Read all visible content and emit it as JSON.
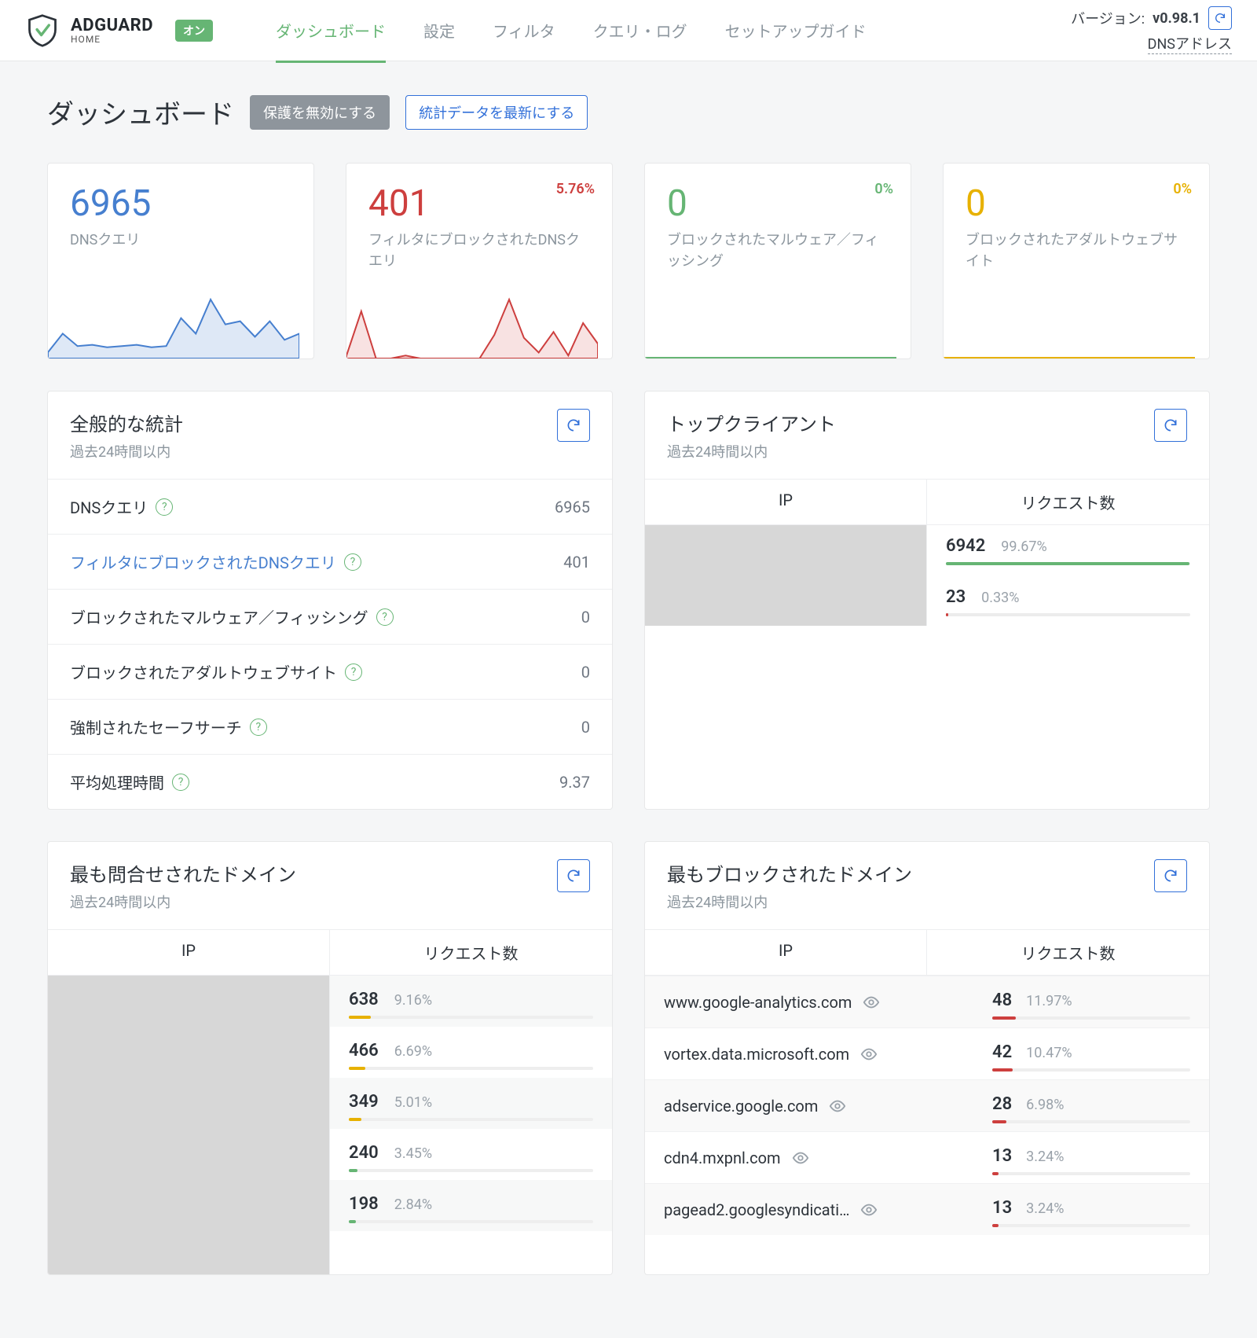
{
  "header": {
    "brand": "ADGUARD",
    "brand_sub": "HOME",
    "on_badge": "オン",
    "nav": [
      "ダッシュボード",
      "設定",
      "フィルタ",
      "クエリ・ログ",
      "セットアップガイド"
    ],
    "version_label": "バージョン:",
    "version_value": "v0.98.1",
    "dns_link": "DNSアドレス"
  },
  "page": {
    "title": "ダッシュボード",
    "btn_disable": "保護を無効にする",
    "btn_refresh_stats": "統計データを最新にする"
  },
  "stats_cards": [
    {
      "num": "6965",
      "label": "DNSクエリ",
      "pct": "",
      "color": "blue"
    },
    {
      "num": "401",
      "label": "フィルタにブロックされたDNSクエリ",
      "pct": "5.76%",
      "color": "red"
    },
    {
      "num": "0",
      "label": "ブロックされたマルウェア／フィッシング",
      "pct": "0%",
      "color": "green"
    },
    {
      "num": "0",
      "label": "ブロックされたアダルトウェブサイト",
      "pct": "0%",
      "color": "yellow"
    }
  ],
  "general_stats": {
    "title": "全般的な統計",
    "subtitle": "過去24時間以内",
    "rows": [
      {
        "name": "DNSクエリ",
        "value": "6965",
        "link": false
      },
      {
        "name": "フィルタにブロックされたDNSクエリ",
        "value": "401",
        "link": true
      },
      {
        "name": "ブロックされたマルウェア／フィッシング",
        "value": "0",
        "link": false
      },
      {
        "name": "ブロックされたアダルトウェブサイト",
        "value": "0",
        "link": false
      },
      {
        "name": "強制されたセーフサーチ",
        "value": "0",
        "link": false
      },
      {
        "name": "平均処理時間",
        "value": "9.37",
        "link": false
      }
    ]
  },
  "top_clients": {
    "title": "トップクライアント",
    "subtitle": "過去24時間以内",
    "col_ip": "IP",
    "col_req": "リクエスト数",
    "rows": [
      {
        "count": "6942",
        "pct": "99.67%",
        "bar": 99.67,
        "color": "#66b574"
      },
      {
        "count": "23",
        "pct": "0.33%",
        "bar": 1,
        "color": "#cd3f3e"
      }
    ]
  },
  "top_queried": {
    "title": "最も問合せされたドメイン",
    "subtitle": "過去24時間以内",
    "col_ip": "IP",
    "col_req": "リクエスト数",
    "rows": [
      {
        "count": "638",
        "pct": "9.16%",
        "bar": 9.16,
        "color": "#e7b100"
      },
      {
        "count": "466",
        "pct": "6.69%",
        "bar": 6.69,
        "color": "#e7b100"
      },
      {
        "count": "349",
        "pct": "5.01%",
        "bar": 5.01,
        "color": "#e7b100"
      },
      {
        "count": "240",
        "pct": "3.45%",
        "bar": 3.45,
        "color": "#66b574"
      },
      {
        "count": "198",
        "pct": "2.84%",
        "bar": 2.84,
        "color": "#66b574"
      }
    ]
  },
  "top_blocked": {
    "title": "最もブロックされたドメイン",
    "subtitle": "過去24時間以内",
    "col_ip": "IP",
    "col_req": "リクエスト数",
    "rows": [
      {
        "domain": "www.google-analytics.com",
        "count": "48",
        "pct": "11.97%",
        "bar": 11.97,
        "color": "#cd3f3e"
      },
      {
        "domain": "vortex.data.microsoft.com",
        "count": "42",
        "pct": "10.47%",
        "bar": 10.47,
        "color": "#cd3f3e"
      },
      {
        "domain": "adservice.google.com",
        "count": "28",
        "pct": "6.98%",
        "bar": 6.98,
        "color": "#cd3f3e"
      },
      {
        "domain": "cdn4.mxpnl.com",
        "count": "13",
        "pct": "3.24%",
        "bar": 3.24,
        "color": "#cd3f3e"
      },
      {
        "domain": "pagead2.googlesyndicati…",
        "count": "13",
        "pct": "3.24%",
        "bar": 3.24,
        "color": "#cd3f3e"
      }
    ]
  },
  "chart_data": [
    {
      "type": "line",
      "title": "DNSクエリ sparkline",
      "values": [
        10,
        40,
        20,
        22,
        18,
        20,
        22,
        18,
        20,
        65,
        40,
        95,
        55,
        60,
        35,
        60,
        30,
        40
      ],
      "ylim": [
        0,
        100
      ]
    },
    {
      "type": "line",
      "title": "ブロック sparkline",
      "values": [
        5,
        80,
        0,
        0,
        5,
        0,
        0,
        0,
        0,
        0,
        40,
        100,
        35,
        10,
        45,
        5,
        60,
        25
      ],
      "ylim": [
        0,
        100
      ]
    }
  ]
}
